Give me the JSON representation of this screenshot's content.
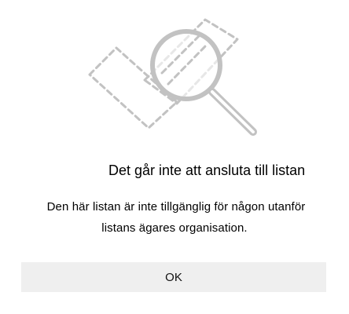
{
  "dialog": {
    "title": "Det går inte att ansluta till listan",
    "message_line1": "Den här listan är inte tillgänglig för någon utanför",
    "message_line2": "listans ägares organisation.",
    "ok_label": "OK"
  },
  "illustration": {
    "icon": "magnifier-over-dashed-document-icon",
    "stroke_color": "#c2c2c2"
  }
}
